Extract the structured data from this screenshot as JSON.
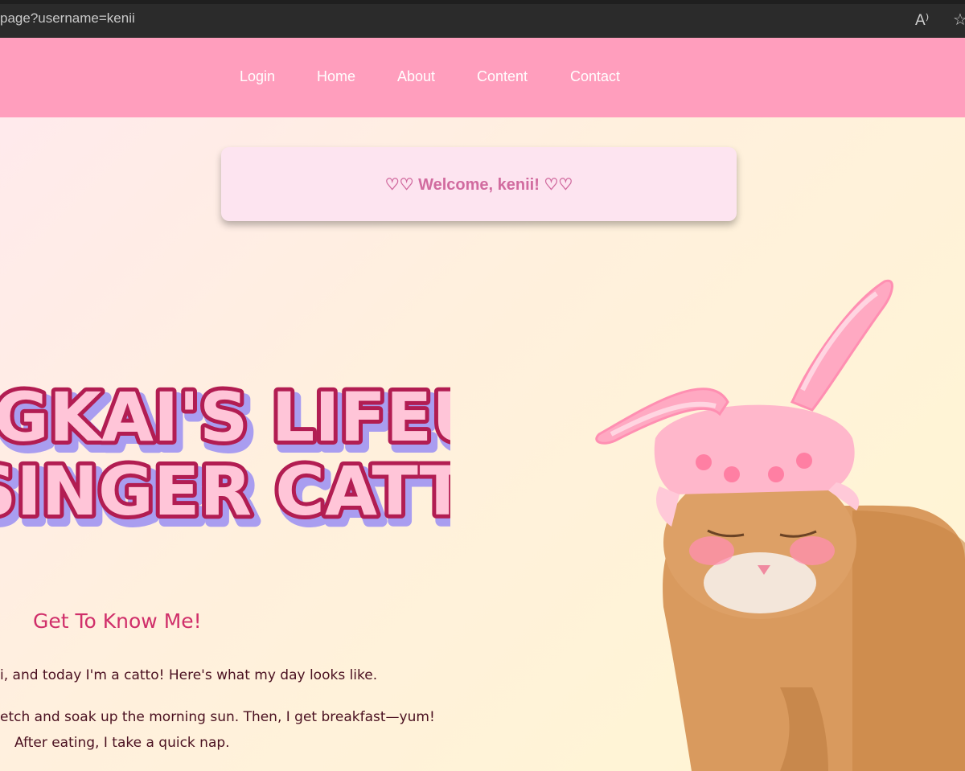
{
  "browser": {
    "url": "page?username=kenii",
    "icons": {
      "read_aloud": "read-aloud-icon",
      "favorite": "star-icon"
    },
    "read_aloud_glyph": "A⁾",
    "favorite_glyph": "☆"
  },
  "nav": {
    "items": [
      {
        "label": "Login"
      },
      {
        "label": "Home"
      },
      {
        "label": "About"
      },
      {
        "label": "Content"
      },
      {
        "label": "Contact"
      }
    ]
  },
  "welcome": {
    "text": "♡♡ Welcome, kenii! ♡♡"
  },
  "logo": {
    "line1": "GKAI'S LIFEU",
    "line2": "SINGER CATTO"
  },
  "about": {
    "heading": "Get To Know Me!",
    "paragraphs": [
      "i, and today I'm a catto! Here's what my day looks like.",
      "etch and soak up the morning sun. Then, I get breakfast—yum!",
      "After eating, I take a quick nap."
    ]
  },
  "colors": {
    "nav_bg": "#ff9ebd",
    "welcome_bg": "#fde4f0",
    "welcome_text": "#d16b9f",
    "heading": "#d02f6a",
    "body_text": "#4a1020",
    "page_gradient_start": "#ffe9ef",
    "page_gradient_end": "#fff6d2"
  }
}
